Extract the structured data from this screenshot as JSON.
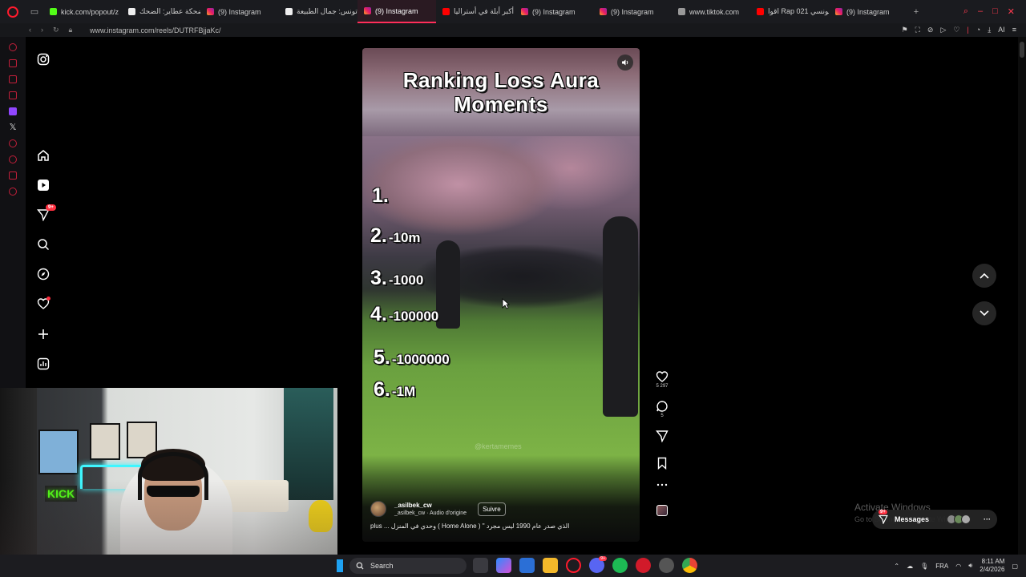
{
  "browser": {
    "tabs": [
      {
        "label": "kick.com/popout/z",
        "favicon": "kick-icon"
      },
      {
        "label": "ضحكة عطاير: الضحك",
        "favicon": "tiktok-icon"
      },
      {
        "label": "(9) Instagram",
        "favicon": "instagram-icon"
      },
      {
        "label": "تونس: جمال الطبيعة",
        "favicon": "tiktok-icon"
      },
      {
        "label": "(9) Instagram",
        "favicon": "instagram-icon",
        "active": true
      },
      {
        "label": "أكبر أبلة في أستراليا",
        "favicon": "youtube-icon"
      },
      {
        "label": "(9) Instagram",
        "favicon": "instagram-icon"
      },
      {
        "label": "(9) Instagram",
        "favicon": "instagram-icon"
      },
      {
        "label": "www.tiktok.com",
        "favicon": "doc-icon"
      },
      {
        "label": "اقوا Rap تونسي 021",
        "favicon": "youtube-icon"
      },
      {
        "label": "(9) Instagram",
        "favicon": "instagram-icon"
      }
    ],
    "url": "www.instagram.com/reels/DUTRFBjjaKc/",
    "ai_label": "AI",
    "new_tab_glyph": "+"
  },
  "instagram_nav": {
    "notifications_badge": "9+"
  },
  "reel": {
    "title_line1": "Ranking Loss Aura",
    "title_line2": "Moments",
    "ranks": [
      {
        "num": "1.",
        "value": ""
      },
      {
        "num": "2.",
        "value": "-10m"
      },
      {
        "num": "3.",
        "value": "-1000"
      },
      {
        "num": "4.",
        "value": "-100000"
      },
      {
        "num": "5.",
        "value": "-1000000"
      },
      {
        "num": "6.",
        "value": "-1M"
      }
    ],
    "watermark": "@kertamemes",
    "author": "_asilbek_cw",
    "audio": "_asilbek_cw · Audio d'origine",
    "follow_label": "Suivre",
    "caption": "plus ... وحدي في المنزل ( Home Alone ) \" الذي صدر عام 1990 ليس مجرد"
  },
  "actions": {
    "likes": "5 297",
    "comments": "5"
  },
  "overlay": {
    "activate_title": "Activate Windows",
    "activate_sub": "Go to Settings to activate Windows.",
    "messages_label": "Messages",
    "messages_badge": "9+",
    "messages_more": "···"
  },
  "taskbar": {
    "search_placeholder": "Search",
    "language": "FRA",
    "time": "8:11 AM",
    "date": "2/4/2026",
    "discord_badge": "9+"
  },
  "colors": {
    "accent_red": "#ff1b2d",
    "instagram_red": "#ff3040",
    "kick_green": "#53fc18"
  }
}
